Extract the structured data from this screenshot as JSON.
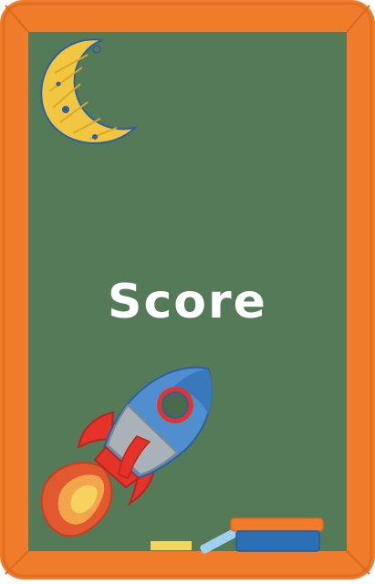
{
  "colors": {
    "frame": "#f07b2a",
    "frame_edge": "#d96a1f",
    "board": "#557a58",
    "chalk_text": "#ffffff"
  },
  "icons": {
    "moon": "crescent-moon-icon",
    "rocket": "rocket-icon",
    "chalk_yellow": "chalk-stick",
    "chalk_blue": "chalk-stick",
    "eraser": "board-eraser"
  },
  "board": {
    "title": "Score"
  }
}
